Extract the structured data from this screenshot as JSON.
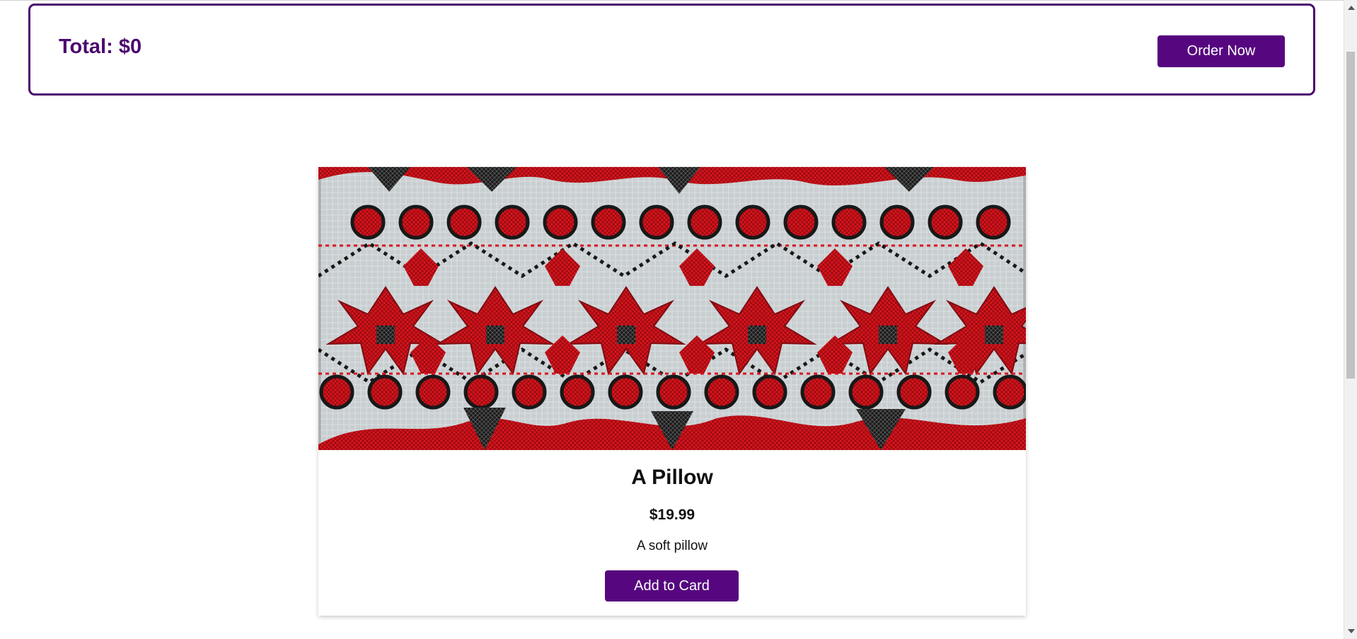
{
  "cart": {
    "total_label": "Total: $0",
    "order_label": "Order Now"
  },
  "product": {
    "title": "A Pillow",
    "price": "$19.99",
    "description": "A soft pillow",
    "add_label": "Add to Card",
    "image_icon": "embroidered-pillow-image"
  },
  "colors": {
    "accent": "#56077f",
    "border": "#4b0a6e",
    "embroidery_red": "#d9141d",
    "embroidery_black": "#181818",
    "fabric": "#c9ced1"
  },
  "scrollbar": {
    "thumb_position_fraction": 0.08,
    "visible_fraction": 0.52
  }
}
